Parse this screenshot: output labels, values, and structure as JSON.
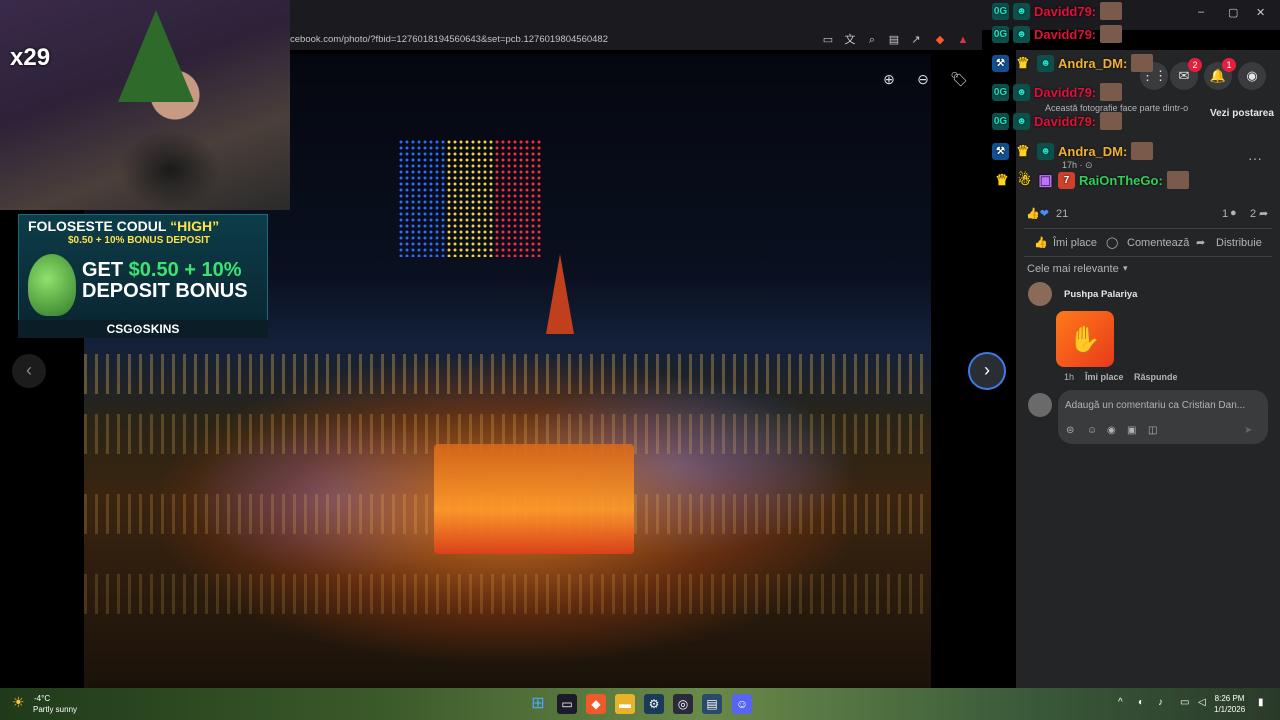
{
  "browser": {
    "url": "cebook.com/photo/?fbid=1276018194560643&set=pcb.1276019804560482",
    "window_controls": {
      "minimize": "–",
      "maximize": "▢",
      "close": "✕"
    }
  },
  "stream_overlay": {
    "combo": "x29",
    "promo": {
      "title_prefix": "FOLOSESTE CODUL",
      "code": "“HIGH”",
      "subtitle": "$0.50 + 10% BONUS DEPOSIT",
      "big_line1_prefix": "GET ",
      "big_line1_amount": "$0.50 + 10%",
      "big_line2": "DEPOSIT BONUS",
      "brand": "CSG⊙SKINS"
    },
    "chat": [
      {
        "user": "Davidd79:",
        "color": "#e0103a",
        "badges": [
          "mod"
        ]
      },
      {
        "user": "Davidd79:",
        "color": "#e0103a",
        "badges": [
          "mod"
        ]
      },
      {
        "user": "Andra_DM:",
        "color": "#f2b134",
        "badges": [
          "vip",
          "crown",
          "sub"
        ]
      },
      {
        "user": "Davidd79:",
        "color": "#e0103a",
        "badges": [
          "mod"
        ]
      },
      {
        "user": "Davidd79:",
        "color": "#e0103a",
        "badges": [
          "mod"
        ]
      },
      {
        "user": "Andra_DM:",
        "color": "#f2b134",
        "badges": [
          "vip",
          "crown",
          "sub"
        ]
      },
      {
        "user": "RaiOnTheGo:",
        "color": "#2fcf5a",
        "badges": [
          "crown",
          "sub"
        ]
      }
    ]
  },
  "photo_viewer": {
    "prev_label": "‹",
    "next_label": "›",
    "zoom_in": "⊕",
    "zoom_out": "⊖",
    "tag": "🏷"
  },
  "facebook": {
    "messenger_badge": "2",
    "notif_badge": "1",
    "post_notice": "Această fotografie face parte dintr-o",
    "see_post": "Vezi postarea",
    "post_time": "17h · ⊙",
    "reactions_count": "21",
    "comments_count": "1",
    "shares_count": "2",
    "like_label": "Îmi place",
    "comment_label": "Comentează",
    "share_label": "Distribuie",
    "relevance": "Cele mai relevante",
    "comment": {
      "author": "Pushpa Palariya",
      "time": "1h",
      "like": "Îmi place",
      "reply": "Răspunde"
    },
    "composer_placeholder": "Adaugă un comentariu ca Cristian Dan..."
  },
  "taskbar": {
    "temperature": "-4°C",
    "weather": "Partly sunny",
    "time": "8:26 PM",
    "date": "1/1/2026"
  }
}
